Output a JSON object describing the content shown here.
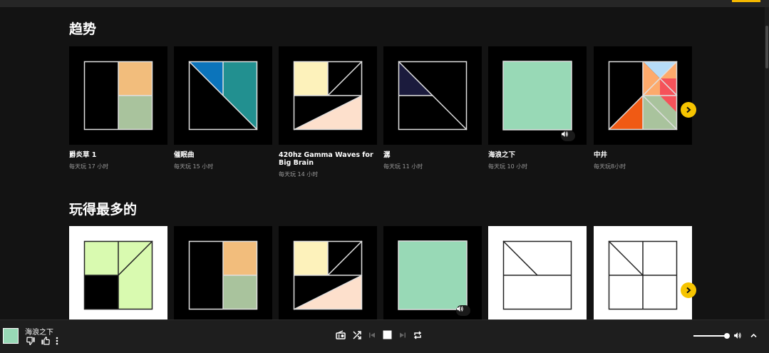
{
  "sections": [
    {
      "title": "趋势",
      "items": [
        {
          "title": "爵炎草 1",
          "subtitle": "每天玩 17 小时"
        },
        {
          "title": "催眠曲",
          "subtitle": "每天玩 15 小时"
        },
        {
          "title": "420hz Gamma Waves for Big Brain",
          "subtitle": "每天玩 14 小时"
        },
        {
          "title": "潺",
          "subtitle": "每天玩 11 小时"
        },
        {
          "title": "海浪之下",
          "subtitle": "每天玩 10 小时"
        },
        {
          "title": "中井",
          "subtitle": "每天玩8小时"
        }
      ]
    },
    {
      "title": "玩得最多的",
      "items": []
    }
  ],
  "player": {
    "now_playing_title": "海浪之下",
    "volume_fraction": 1.0
  },
  "icons": {
    "next": "chevron-right-icon",
    "speaker": "volume-icon",
    "thumbs_down": "thumbs-down-icon",
    "thumbs_up": "thumbs-up-icon",
    "more": "more-vert-icon",
    "radio": "radio-icon",
    "shuffle": "shuffle-icon",
    "previous": "skip-previous-icon",
    "stop": "stop-icon",
    "skip_next": "skip-next-icon",
    "repeat": "repeat-icon",
    "expand": "chevron-up-icon"
  },
  "colors": {
    "accent": "#f6c400",
    "background": "#131313",
    "player_bar": "#1e1e1e"
  }
}
